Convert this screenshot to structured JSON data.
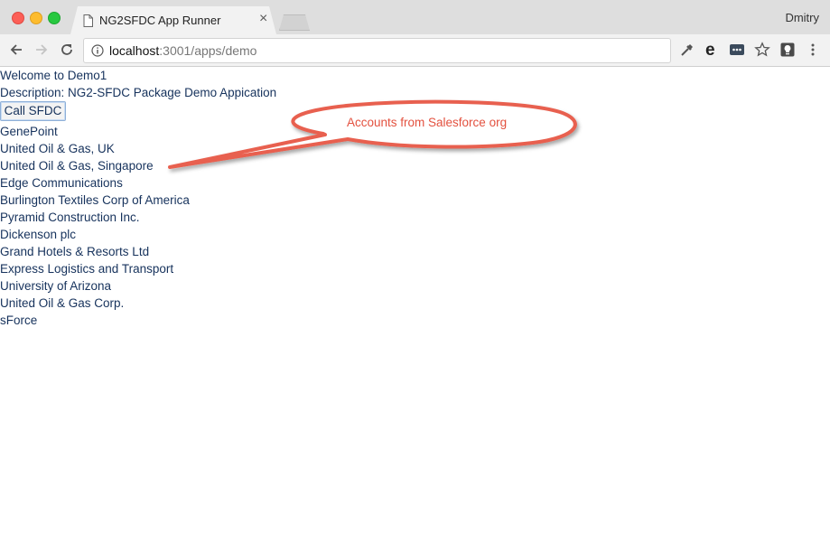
{
  "browser": {
    "tab_title": "NG2SFDC App Runner",
    "user_name": "Dmitry",
    "url_host": "localhost",
    "url_rest": ":3001/apps/demo"
  },
  "page": {
    "welcome": "Welcome to Demo1",
    "description": "Description: NG2-SFDC Package Demo Appication",
    "call_button_label": "Call SFDC",
    "accounts": [
      "GenePoint",
      "United Oil & Gas, UK",
      "United Oil & Gas, Singapore",
      "Edge Communications",
      "Burlington Textiles Corp of America",
      "Pyramid Construction Inc.",
      "Dickenson plc",
      "Grand Hotels & Resorts Ltd",
      "Express Logistics and Transport",
      "University of Arizona",
      "United Oil & Gas Corp.",
      "sForce"
    ]
  },
  "annotation": {
    "callout_text": "Accounts from Salesforce org",
    "color": "#e3513f"
  },
  "icons": {
    "back": "arrow-left-icon",
    "forward": "arrow-right-icon",
    "reload": "reload-icon",
    "info": "info-icon",
    "eyedropper": "eyedropper-icon",
    "edge": "e-icon",
    "password": "password-dots-icon",
    "star": "star-icon",
    "lightbulb": "lightbulb-icon",
    "menu": "kebab-menu-icon"
  }
}
